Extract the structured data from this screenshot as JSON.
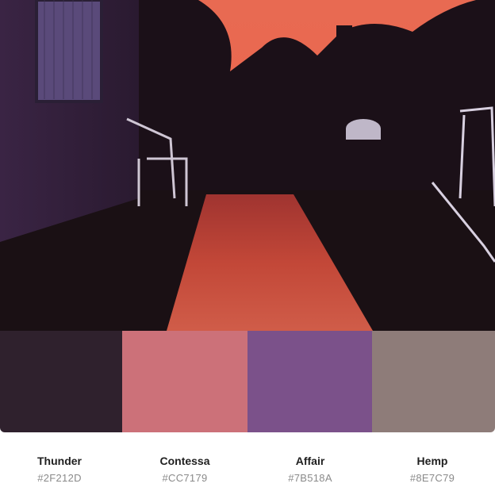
{
  "palette": {
    "colors": [
      {
        "name": "Thunder",
        "hex": "#2F212D"
      },
      {
        "name": "Contessa",
        "hex": "#CC7179"
      },
      {
        "name": "Affair",
        "hex": "#7B518A"
      },
      {
        "name": "Hemp",
        "hex": "#8E7C79"
      }
    ]
  },
  "photo": {
    "sky_color": "#f06a4a",
    "wall_color": "#3a2444",
    "reflection_color": "#e0513e"
  }
}
